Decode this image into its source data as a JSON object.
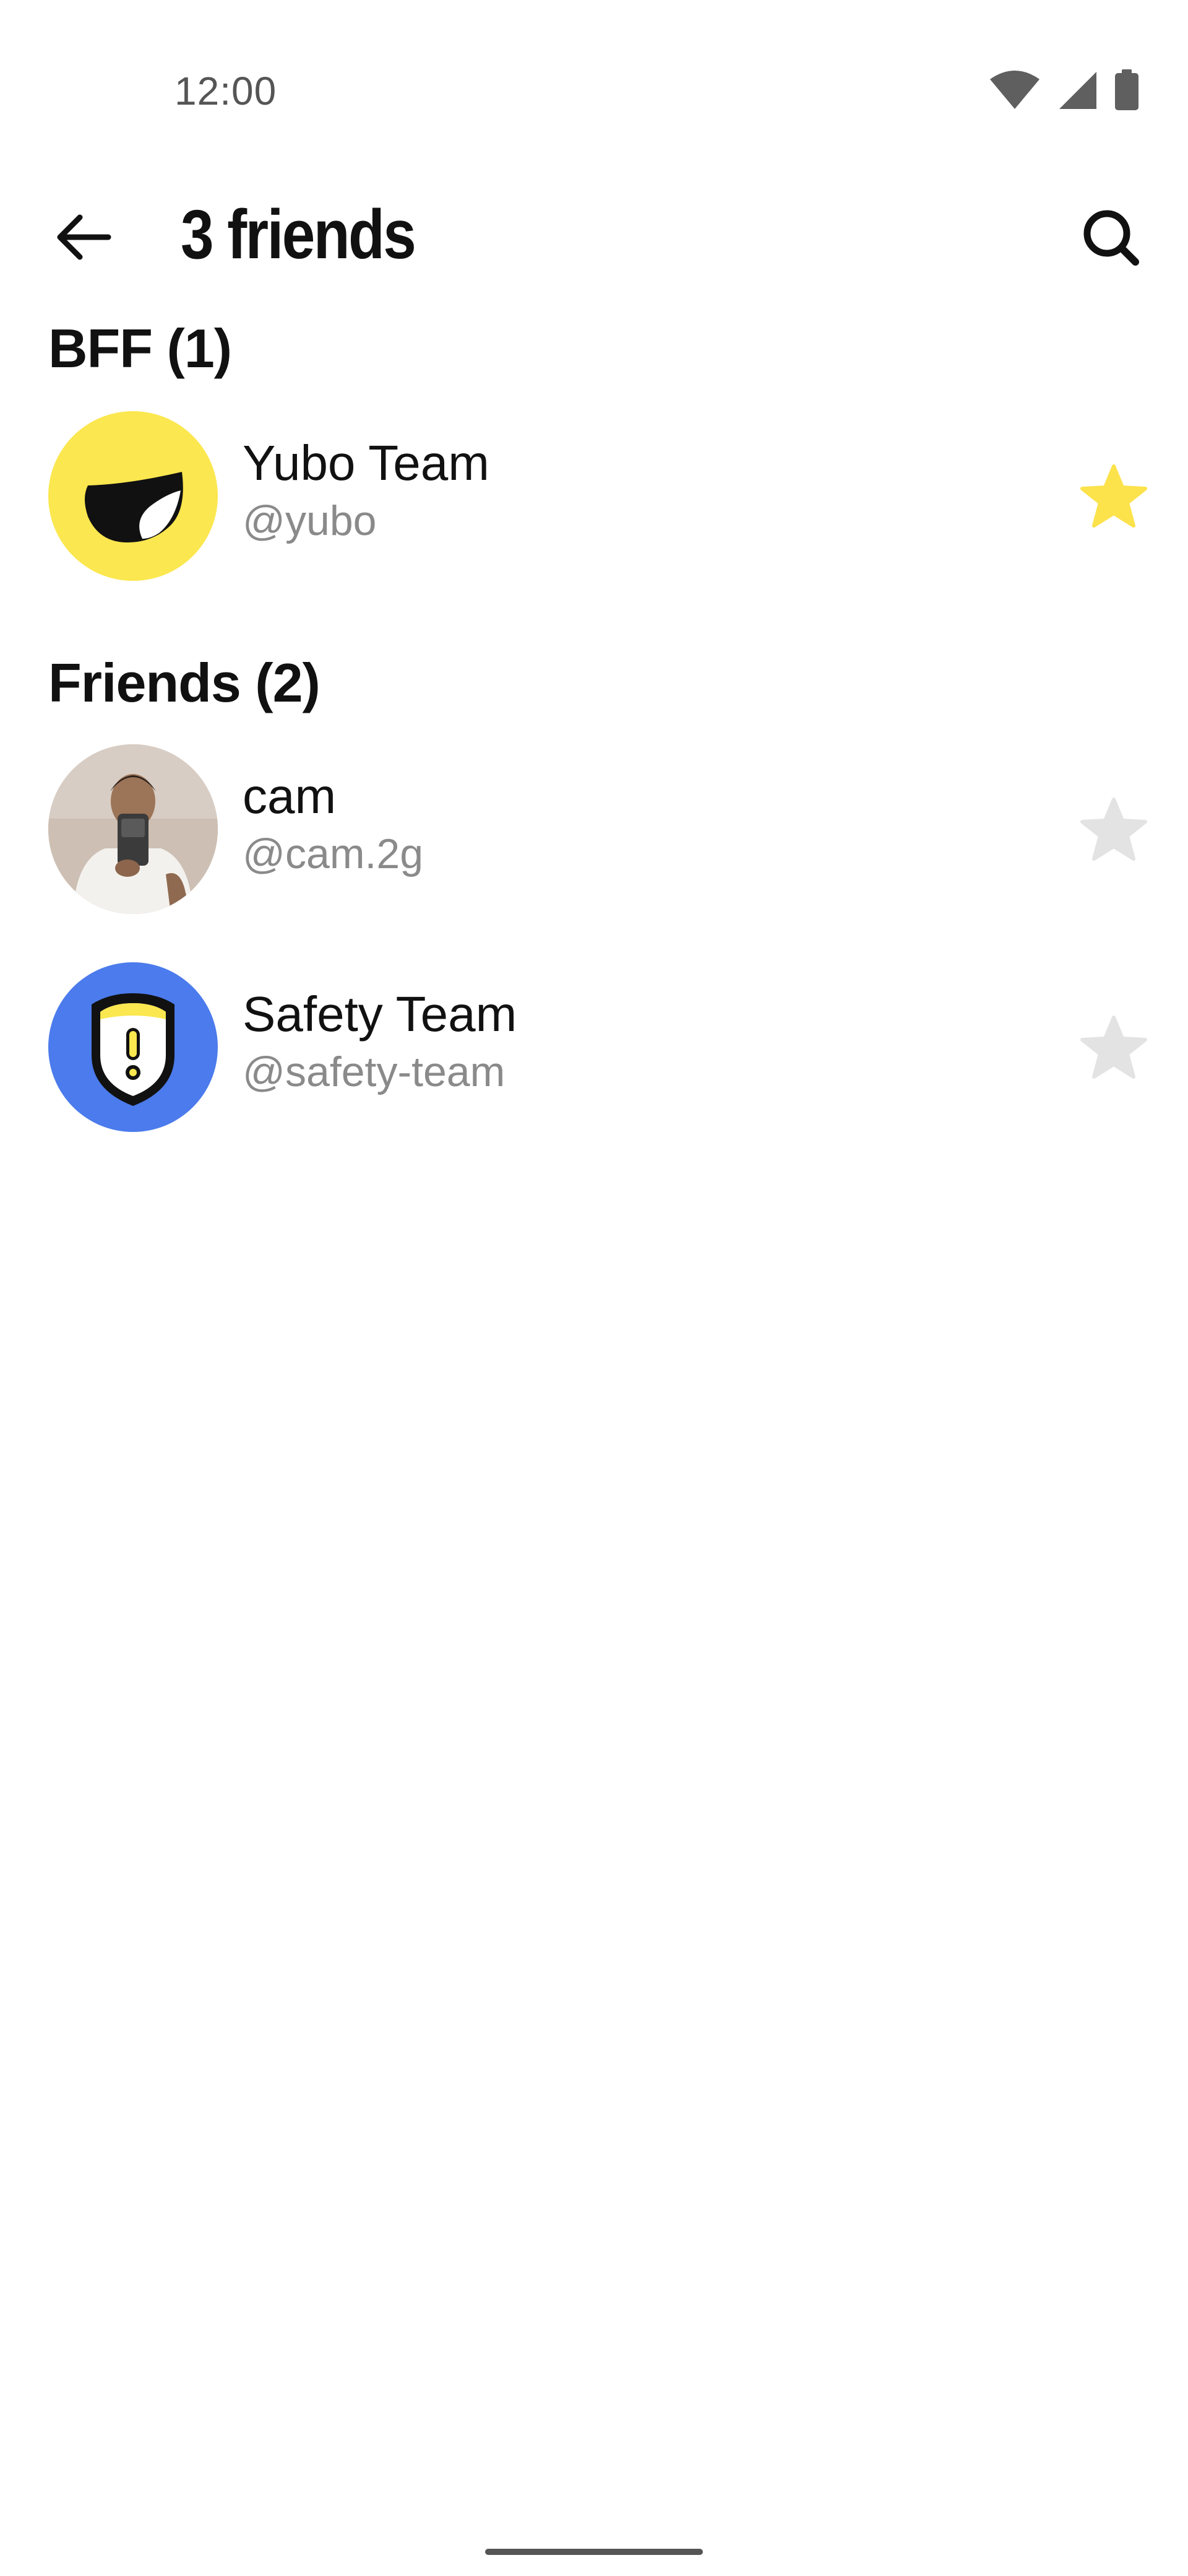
{
  "status_bar": {
    "time": "12:00",
    "icons": [
      "wifi-icon",
      "cell-signal-icon",
      "battery-icon"
    ]
  },
  "header": {
    "title": "3 friends",
    "back_icon": "arrow-left-icon",
    "search_icon": "search-icon"
  },
  "sections": [
    {
      "title": "BFF (1)",
      "friends": [
        {
          "name": "Yubo Team",
          "handle": "@yubo",
          "avatar": "yubo-logo",
          "starred": true
        }
      ]
    },
    {
      "title": "Friends (2)",
      "friends": [
        {
          "name": "cam",
          "handle": "@cam.2g",
          "avatar": "photo",
          "starred": false
        },
        {
          "name": "Safety Team",
          "handle": "@safety-team",
          "avatar": "safety-shield",
          "starred": false
        }
      ]
    }
  ],
  "colors": {
    "star_active": "#FCE24B",
    "star_inactive": "#E3E3E3",
    "yubo_yellow": "#FBE74F",
    "safety_blue": "#4B7BEC",
    "handle_gray": "#8A8A8A"
  }
}
